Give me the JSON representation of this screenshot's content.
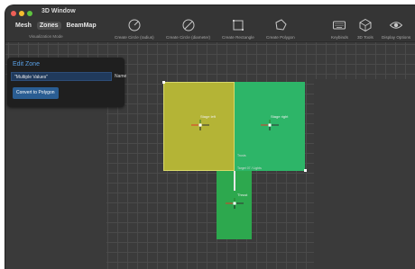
{
  "window": {
    "title": "3D Window"
  },
  "modes": [
    "Mesh",
    "Zones",
    "BeamMap"
  ],
  "mode_caption": "Visualization Mode",
  "tools": [
    {
      "label": "Create Circle (radius)",
      "icon": "circle-radius-icon"
    },
    {
      "label": "Create Circle (diameter)",
      "icon": "circle-diameter-icon"
    },
    {
      "label": "Create Rectangle",
      "icon": "rectangle-icon"
    },
    {
      "label": "Create Polygon",
      "icon": "polygon-icon"
    },
    {
      "label": "Keybinds",
      "icon": "keyboard-icon"
    },
    {
      "label": "3D Tools",
      "icon": "3d-tools-icon"
    },
    {
      "label": "Display Options",
      "icon": "eye-icon"
    }
  ],
  "panel": {
    "title": "Edit Zone",
    "field_value": "\"Multiple Values\"",
    "field_label": "Name",
    "button": "Convert to Polygon"
  },
  "zones": {
    "left": {
      "label": "Stage left",
      "color": "#b5b536"
    },
    "right": {
      "label": "Stage right",
      "color": "#2db567"
    },
    "bottom": {
      "label": "Thrust",
      "color": "#2ca74d"
    }
  },
  "canvas_labels": {
    "small_1": "Trusts",
    "small_2": "Target 07 / Lights"
  }
}
